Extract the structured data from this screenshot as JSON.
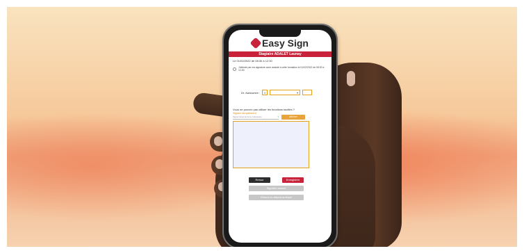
{
  "app": {
    "logo_text": "Easy Sign",
    "brand_color": "#c9233b"
  },
  "session": {
    "banner": "Stagiaire ADALET Launay",
    "date_line": "Le 01/02/2022 de 08:30 à 12:30",
    "consent_text": "J'atteste par ma signature avoir assisté à cette formation le 01/02/2022 de 08:30 à 12:30"
  },
  "birth": {
    "label": "Dt. Naissance :",
    "day_value": "0",
    "month_value": "",
    "year_value": ""
  },
  "signature_functions": {
    "question": "Vous ne pouvez pas utiliser les fonctions tactiles ?",
    "link": "Signez simplement",
    "select_placeholder": "Signer dans la zone ci-dessous",
    "afficher_label": "Afficher"
  },
  "actions": {
    "retour_label": "Retour",
    "enregistrer_label": "Enregistrer",
    "signaler_label": "Signaler absent",
    "retard_label": "Retard ou départ anticipé"
  }
}
